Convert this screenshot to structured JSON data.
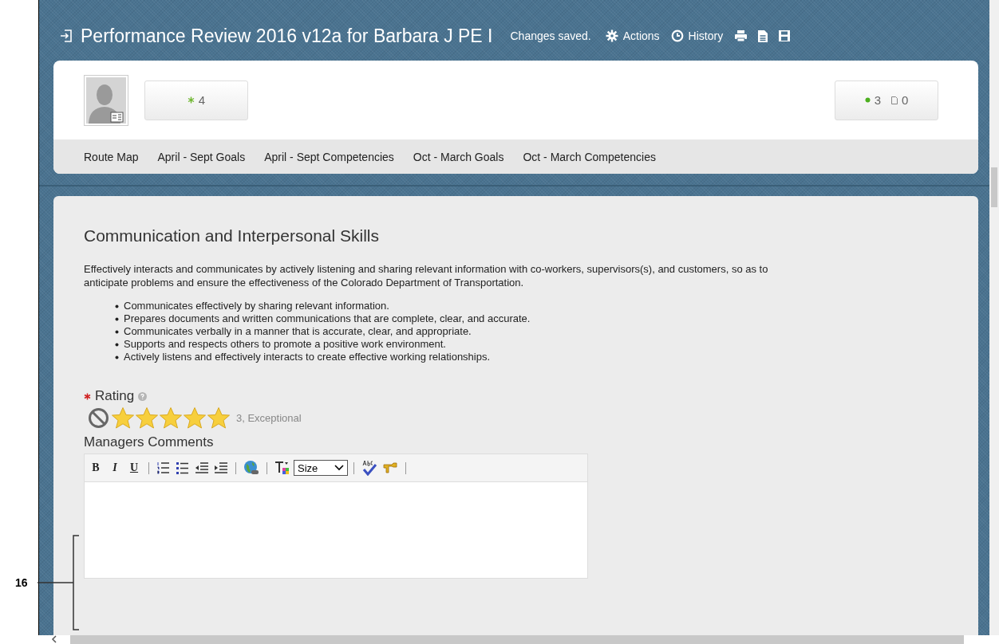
{
  "header": {
    "title": "Performance Review 2016 v12a for Barbara J PE I",
    "status": "Changes saved.",
    "actions": [
      {
        "kind": "gear",
        "label": "Actions"
      },
      {
        "kind": "clock",
        "label": "History"
      },
      {
        "kind": "print"
      },
      {
        "kind": "document"
      },
      {
        "kind": "save"
      }
    ]
  },
  "summary": {
    "goals_count": "4",
    "badges": [
      {
        "kind": "dot",
        "value": "3"
      },
      {
        "kind": "doc",
        "value": "0"
      }
    ]
  },
  "tabs": [
    {
      "label": "Route Map",
      "selected": false
    },
    {
      "label": "April - Sept Goals",
      "selected": false
    },
    {
      "label": "April - Sept Competencies",
      "selected": false
    },
    {
      "label": "Oct - March Goals",
      "selected": false
    },
    {
      "label": "Oct - March Competencies",
      "selected": false
    }
  ],
  "competency": {
    "title": "Communication and Interpersonal Skills",
    "description": "Effectively interacts and communicates by actively listening and sharing relevant information with co-workers, supervisors(s), and customers, so as to anticipate problems and ensure the effectiveness of the Colorado Department of Transportation.",
    "bullets": [
      "Communicates effectively by sharing relevant information.",
      "Prepares documents and written communications that are complete, clear, and accurate.",
      "Communicates verbally in a manner that is accurate, clear, and appropriate.",
      "Supports and respects others to promote a positive work environment.",
      "Actively listens and effectively interacts to create effective working relationships."
    ],
    "rating": {
      "label": "Rating",
      "required": true,
      "stars": 5,
      "reading": "3, Exceptional"
    },
    "comments": {
      "label": "Managers Comments",
      "toolbar": [
        {
          "kind": "text",
          "label": "B"
        },
        {
          "kind": "text",
          "label": "I"
        },
        {
          "kind": "text",
          "label": "U"
        },
        {
          "kind": "sep"
        },
        {
          "kind": "numbered-list"
        },
        {
          "kind": "bullet-list"
        },
        {
          "kind": "outdent"
        },
        {
          "kind": "indent"
        },
        {
          "kind": "sep"
        },
        {
          "kind": "link"
        },
        {
          "kind": "sep"
        },
        {
          "kind": "text-color"
        },
        {
          "kind": "select",
          "label": "Size"
        },
        {
          "kind": "sep"
        },
        {
          "kind": "spellcheck"
        },
        {
          "kind": "clean"
        },
        {
          "kind": "sep"
        }
      ]
    }
  },
  "callout": {
    "label": "16"
  }
}
